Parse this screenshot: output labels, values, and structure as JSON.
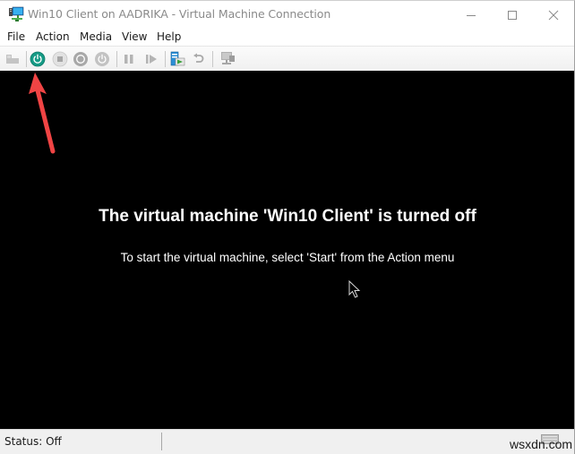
{
  "window": {
    "title": "Win10 Client on AADRIKA - Virtual Machine Connection",
    "controls": {
      "minimize": "minimize-icon",
      "maximize": "maximize-icon",
      "close": "close-icon"
    }
  },
  "menubar": {
    "items": [
      {
        "label": "File"
      },
      {
        "label": "Action"
      },
      {
        "label": "Media"
      },
      {
        "label": "View"
      },
      {
        "label": "Help"
      }
    ]
  },
  "toolbar": {
    "buttons": [
      {
        "name": "ctrl-alt-del",
        "icon": "ctrl-alt-del-icon",
        "enabled": false
      },
      {
        "name": "start",
        "icon": "power-start-icon",
        "enabled": true,
        "color": "#1a9e8a"
      },
      {
        "name": "turn-off",
        "icon": "stop-icon",
        "enabled": false
      },
      {
        "name": "shut-down",
        "icon": "shutdown-icon",
        "enabled": false
      },
      {
        "name": "save",
        "icon": "save-state-icon",
        "enabled": false
      },
      {
        "name": "pause",
        "icon": "pause-icon",
        "enabled": false
      },
      {
        "name": "resume",
        "icon": "resume-icon",
        "enabled": false
      },
      {
        "name": "checkpoint",
        "icon": "checkpoint-icon",
        "enabled": true
      },
      {
        "name": "revert",
        "icon": "revert-icon",
        "enabled": false
      },
      {
        "name": "enhanced-session",
        "icon": "enhanced-session-icon",
        "enabled": false
      }
    ]
  },
  "screen": {
    "title": "The virtual machine 'Win10 Client' is turned off",
    "subtitle": "To start the virtual machine, select 'Start' from the Action menu",
    "background": "#000000",
    "annotation_color": "#f04040"
  },
  "statusbar": {
    "status": "Status: Off",
    "watermark": "wsxdn.com"
  }
}
